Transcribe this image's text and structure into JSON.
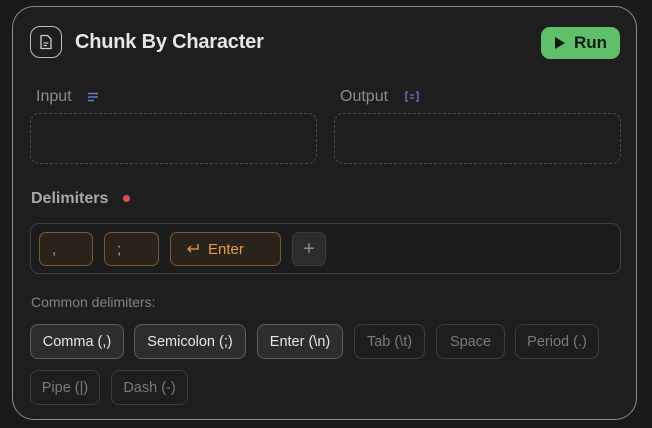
{
  "node": {
    "title": "Chunk By Character",
    "icon": "document-icon",
    "run_label": "Run",
    "run_color": "#5fbf6b"
  },
  "ports": {
    "input_label": "Input",
    "input_icon": "text-lines-icon",
    "output_label": "Output",
    "output_icon": "list-brackets-icon"
  },
  "delimiters": {
    "title": "Delimiters",
    "required_color": "#e04b4b",
    "chips": [
      {
        "label": ",",
        "icon": ""
      },
      {
        "label": ";",
        "icon": ""
      },
      {
        "label": "Enter",
        "icon": "return-arrow-icon"
      }
    ],
    "chip_color": "#e39a4b",
    "add_label": "+"
  },
  "common": {
    "label": "Common delimiters:",
    "options": [
      {
        "label": "Comma (,)",
        "selected": true
      },
      {
        "label": "Semicolon (;)",
        "selected": true
      },
      {
        "label": "Enter (\\n)",
        "selected": true
      },
      {
        "label": "Tab (\\t)",
        "selected": false
      },
      {
        "label": "Space",
        "selected": false
      },
      {
        "label": "Period (.)",
        "selected": false
      },
      {
        "label": "Pipe (|)",
        "selected": false
      },
      {
        "label": "Dash (-)",
        "selected": false
      }
    ]
  }
}
